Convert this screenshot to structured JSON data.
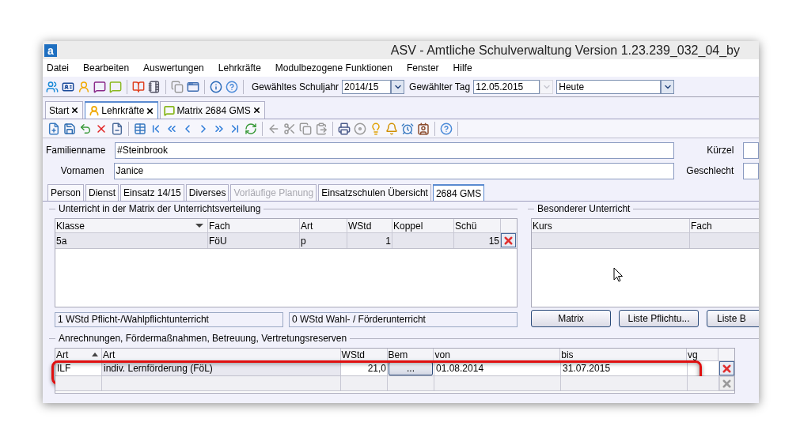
{
  "window": {
    "app_icon": "a",
    "title": "ASV - Amtliche Schulverwaltung Version 1.23.239_032_04_by"
  },
  "menu": [
    "Datei",
    "Bearbeiten",
    "Auswertungen",
    "Lehrkräfte",
    "Modulbezogene Funktionen",
    "Fenster",
    "Hilfe"
  ],
  "toolbar": {
    "year_label": "Gewähltes Schuljahr",
    "year": "2014/15",
    "day_label": "Gewählter Tag",
    "day": "12.05.2015",
    "day_dropdown_disabled": true,
    "view": "Heute"
  },
  "doc_tabs": [
    {
      "label": "Start",
      "kind": "plain",
      "selected": false
    },
    {
      "label": "Lehrkräfte",
      "kind": "teachers",
      "selected": true
    },
    {
      "label": "Matrix 2684 GMS",
      "kind": "matrix",
      "selected": false
    }
  ],
  "form": [
    {
      "label": "Familienname",
      "value": "#Steinbrook",
      "side_label": "Kürzel"
    },
    {
      "label": "Vornamen",
      "value": "Janice",
      "side_label": "Geschlecht"
    }
  ],
  "tabs": [
    {
      "label": "Person",
      "selected": false,
      "disabled": false
    },
    {
      "label": "Dienst",
      "selected": false,
      "disabled": false
    },
    {
      "label": "Einsatz 14/15",
      "selected": false,
      "disabled": false
    },
    {
      "label": "Diverses",
      "selected": false,
      "disabled": false
    },
    {
      "label": "Vorläufige Planung",
      "selected": false,
      "disabled": true
    },
    {
      "label": "Einsatzschulen Übersicht",
      "selected": false,
      "disabled": false
    },
    {
      "label": "2684 GMS",
      "selected": true,
      "disabled": false
    }
  ],
  "matrix": {
    "title": "Unterricht in der Matrix der Unterrichtsverteilung",
    "columns": [
      {
        "label": "Klasse",
        "sorted": true
      },
      {
        "label": "Fach",
        "sorted": false
      },
      {
        "label": "Art",
        "sorted": false
      },
      {
        "label": "WStd",
        "sorted": false
      },
      {
        "label": "Koppel",
        "sorted": false
      },
      {
        "label": "Schü",
        "sorted": false
      }
    ],
    "rows": [
      {
        "cells": [
          "5a",
          "FöU",
          "p",
          "1",
          null,
          "15"
        ],
        "selected": true
      }
    ],
    "summary": [
      "1 WStd Pflicht-/Wahlpflichtunterricht",
      "0 WStd Wahl- / Förderunterricht"
    ]
  },
  "special": {
    "title": "Besonderer Unterricht",
    "columns": [
      "Kurs",
      "Fach"
    ],
    "buttons": [
      "Matrix",
      "Liste Pflichtu...",
      "Liste B"
    ]
  },
  "credits": {
    "title": "Anrechnungen, Fördermaßnahmen, Betreuung, Vertretungsreserven",
    "columns": [
      {
        "label": "Art",
        "sorted": true
      },
      {
        "label": "Art",
        "sorted": false
      },
      {
        "label": "WStd",
        "sorted": false
      },
      {
        "label": "Bem",
        "sorted": false
      },
      {
        "label": "von",
        "sorted": false
      },
      {
        "label": "bis",
        "sorted": false
      },
      {
        "label": "vg",
        "sorted": false
      }
    ],
    "rows": [
      {
        "kind": "entry",
        "cells": [
          "ILF",
          "indiv. Lernförderung (FöL)",
          "21,0",
          "...",
          "01.08.2014",
          "31.07.2015",
          null
        ],
        "highlighted": true
      },
      {
        "kind": "blank",
        "highlighted": false
      }
    ]
  }
}
